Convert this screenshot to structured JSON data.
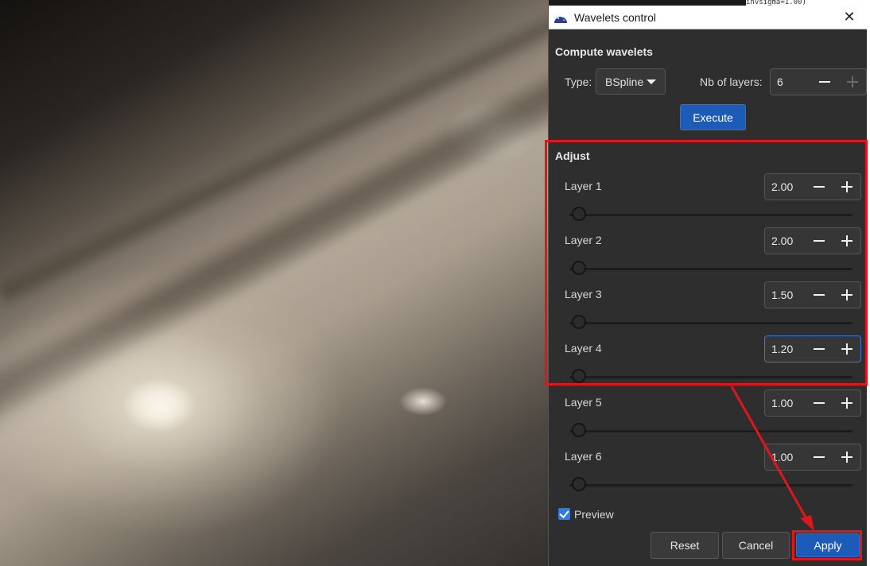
{
  "terminal_snippet": "invsigma=1.00)",
  "dialog": {
    "title": "Wavelets control",
    "close_glyph": "✕",
    "compute": {
      "heading": "Compute wavelets",
      "type_label": "Type:",
      "type_value": "BSpline",
      "layers_label": "Nb of layers:",
      "layers_value": "6",
      "execute_label": "Execute"
    },
    "adjust": {
      "heading": "Adjust",
      "layers": [
        {
          "label": "Layer 1",
          "value": "2.00",
          "level": 0
        },
        {
          "label": "Layer 2",
          "value": "2.00",
          "level": 0
        },
        {
          "label": "Layer 3",
          "value": "1.50",
          "level": 0
        },
        {
          "label": "Layer 4",
          "value": "1.20",
          "level": 0
        },
        {
          "label": "Layer 5",
          "value": "1.00",
          "level": 0
        },
        {
          "label": "Layer 6",
          "value": "1.00",
          "level": 0
        }
      ]
    },
    "preview_label": "Preview",
    "preview_checked": true,
    "reset_label": "Reset",
    "cancel_label": "Cancel",
    "apply_label": "Apply"
  },
  "colors": {
    "accent": "#1c5bb8",
    "highlight": "#e0161c"
  }
}
